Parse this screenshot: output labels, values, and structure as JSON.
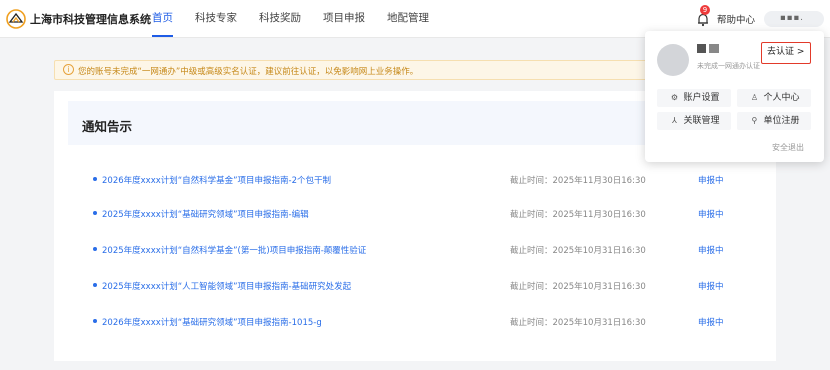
{
  "header": {
    "site_title": "上海市科技管理信息系统",
    "nav": [
      "首页",
      "科技专家",
      "科技奖励",
      "项目申报",
      "地配管理"
    ],
    "badge_count": "9",
    "help_label": "帮助中心",
    "accent_color": "#1e5ce6"
  },
  "notice": {
    "text": "您的账号未完成“一网通办”中级或高级实名认证，建议前往认证，以免影响网上业务操作。"
  },
  "main": {
    "title": "通知告示",
    "rows": [
      {
        "title": "2026年度xxxx计划“自然科学基金”项目申报指南-2个包干制",
        "deadline": "截止时间：2025年11月30日16:30",
        "status": "申报中"
      },
      {
        "title": "2025年度xxxx计划“基础研究领域”项目申报指南-编辑",
        "deadline": "截止时间：2025年11月30日16:30",
        "status": "申报中"
      },
      {
        "title": "2025年度xxxx计划“自然科学基金”(第一批)项目申报指南-颠覆性验证",
        "deadline": "截止时间：2025年10月31日16:30",
        "status": "申报中"
      },
      {
        "title": "2025年度xxxx计划“人工智能领域”项目申报指南-基础研究处发起",
        "deadline": "截止时间：2025年10月31日16:30",
        "status": "申报中"
      },
      {
        "title": "2026年度xxxx计划“基础研究领域”项目申报指南-1015-g",
        "deadline": "截止时间：2025年10月31日16:30",
        "status": "申报中"
      }
    ]
  },
  "popover": {
    "sub_text": "未完成一网通办认证",
    "cert_label": "去认证 >",
    "buttons": [
      {
        "icon": "gear-icon",
        "label": "账户设置"
      },
      {
        "icon": "person-icon",
        "label": "个人中心"
      },
      {
        "icon": "link-icon",
        "label": "关联管理"
      },
      {
        "icon": "org-icon",
        "label": "单位注册"
      }
    ],
    "logout_label": "安全退出"
  }
}
